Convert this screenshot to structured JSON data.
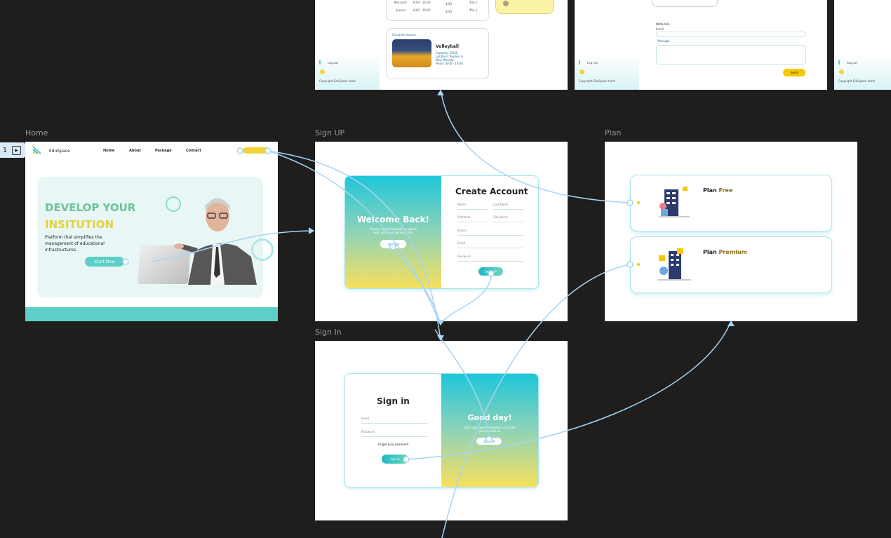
{
  "frames": {
    "home": "Home",
    "signup": "Sign UP",
    "plan": "Plan",
    "signin": "Sign In"
  },
  "flow": {
    "number": "1"
  },
  "top_frames": {
    "schedule_rows": [
      {
        "day": "Miercoles",
        "time": "8:00 - 10:00",
        "cap": "4/30",
        "price": "45$ ¢"
      },
      {
        "day": "Jueves",
        "time": "8:00 - 10:00",
        "cap": "4/30",
        "price": "45$ ¢"
      }
    ],
    "occupied_title": "Occupied spaces",
    "venue_name": "Volleyball",
    "venue_details": [
      "Capacity: 30/30",
      "Location: Pavilion A",
      "Day: Monday",
      "Hours: 8:00 - 10:00"
    ],
    "logout": "Log out",
    "copyright": "Copyright EduSpace team",
    "write_him": "Write him",
    "email_label": "Email",
    "message_label": "Message",
    "send_label": "Send"
  },
  "home": {
    "brand": "EduSpace",
    "nav": [
      "Home",
      "About",
      "Package",
      "Contact"
    ],
    "headline_1": "DEVELOP YOUR",
    "headline_2": "INSITUTION",
    "description": "Platform that simplifies the management of educational infrastructures.",
    "cta": "Start Now",
    "colors": {
      "teal": "#5ccfc6",
      "yellow": "#e6cf3a",
      "green": "#6cc49a"
    }
  },
  "signup": {
    "welcome_title": "Welcome Back!",
    "welcome_text": "To keep connected with us please login with your personal info",
    "welcome_button": "SIGN UP",
    "title": "Create Account",
    "fields": [
      "Name",
      "Last Name",
      "Birthdate",
      "Cell phone",
      "Status",
      "Email",
      "Password"
    ],
    "submit": "SIGN UP"
  },
  "signin": {
    "title": "Sign in",
    "fields": [
      "Email",
      "Password"
    ],
    "forgot": "Forget your password",
    "submit": "Sign in",
    "greeting_title": "Good day!",
    "greeting_text": "Enter your personal details and start journey with us",
    "greeting_button": "SIGN UP"
  },
  "plan": {
    "plans": [
      {
        "prefix": "Plan",
        "name": "Free"
      },
      {
        "prefix": "Plan",
        "name": "Premium"
      }
    ]
  },
  "connector_color": "#a8d4f5"
}
